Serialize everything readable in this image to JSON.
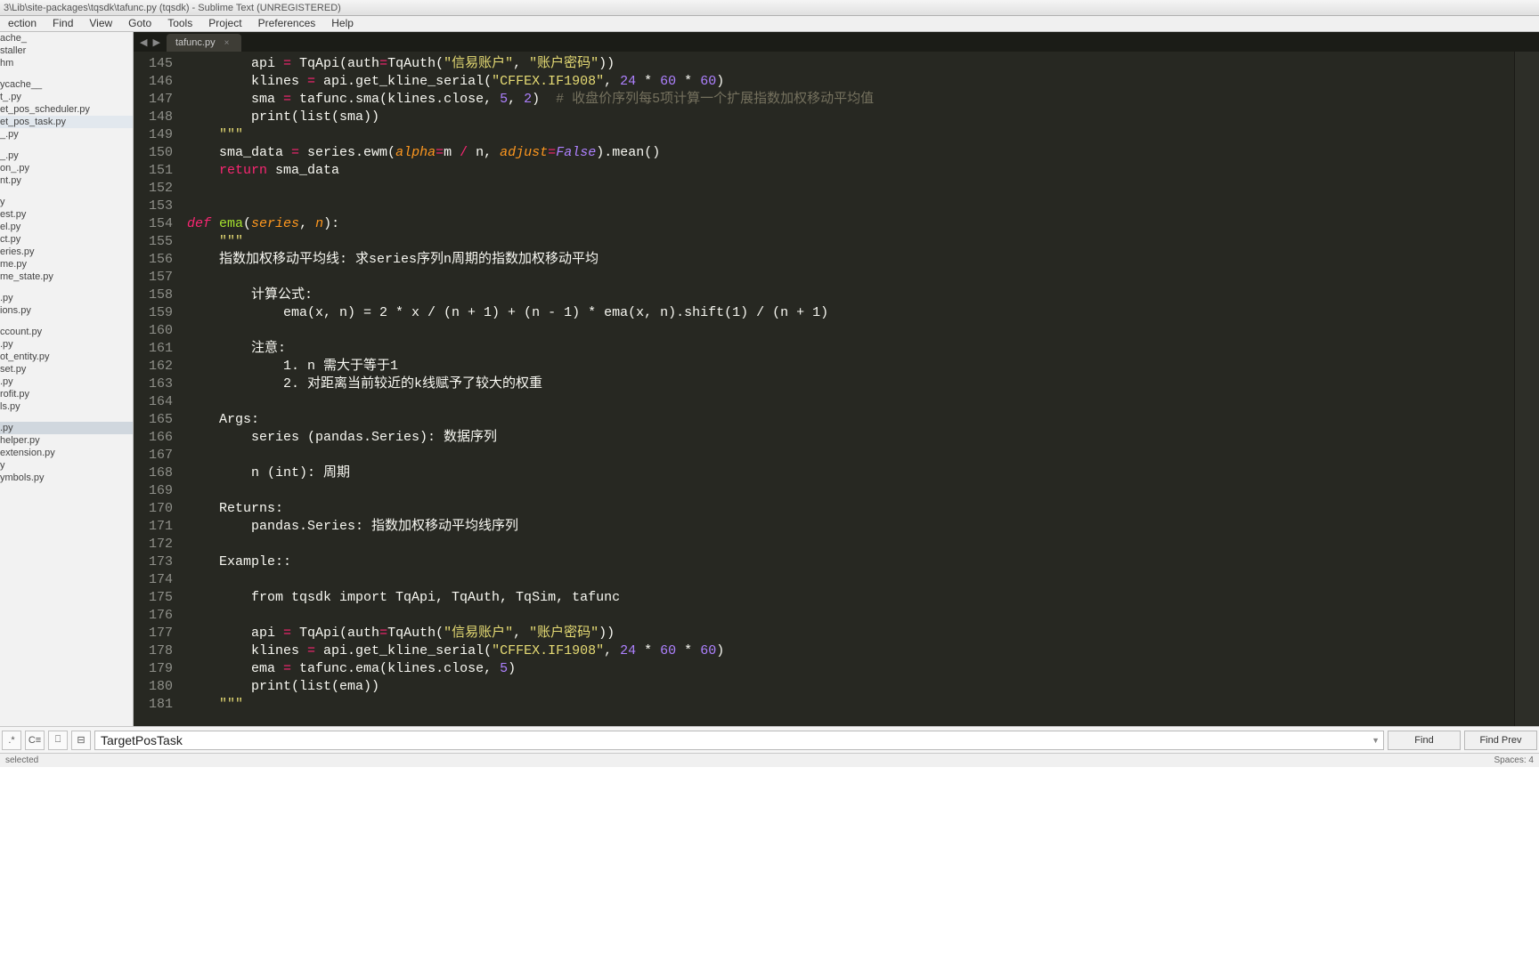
{
  "title": "3\\Lib\\site-packages\\tqsdk\\tafunc.py (tqsdk) - Sublime Text (UNREGISTERED)",
  "menu": [
    "ection",
    "Find",
    "View",
    "Goto",
    "Tools",
    "Project",
    "Preferences",
    "Help"
  ],
  "sidebar": {
    "groups": [
      [
        "ache_",
        "staller",
        "hm"
      ],
      [
        "ycache__",
        "t_.py",
        "et_pos_scheduler.py",
        "et_pos_task.py",
        "_.py"
      ],
      [
        "_.py",
        "on_.py",
        "nt.py"
      ],
      [
        "y",
        "est.py",
        "el.py",
        "ct.py",
        "eries.py",
        "me.py",
        "me_state.py"
      ],
      [
        ".py",
        "ions.py"
      ],
      [
        "ccount.py",
        ".py",
        "ot_entity.py",
        "set.py",
        ".py",
        "rofit.py",
        "ls.py"
      ],
      [
        ".py",
        "helper.py",
        "extension.py",
        "y",
        "ymbols.py"
      ]
    ],
    "selected": ".py",
    "highlighted": "et_pos_task.py"
  },
  "tab": {
    "label": "tafunc.py"
  },
  "lines_start": 145,
  "lines_end": 181,
  "code": [
    {
      "n": 145,
      "seg": [
        [
          "        api ",
          ""
        ],
        [
          "= ",
          "kw2"
        ],
        [
          "TqApi(auth",
          ""
        ],
        [
          "=",
          "kw2"
        ],
        [
          "TqAuth(",
          ""
        ],
        [
          "\"信易账户\"",
          "str"
        ],
        [
          ", ",
          ""
        ],
        [
          "\"账户密码\"",
          "str"
        ],
        [
          "))",
          ""
        ]
      ]
    },
    {
      "n": 146,
      "seg": [
        [
          "        klines ",
          ""
        ],
        [
          "= ",
          "kw2"
        ],
        [
          "api.get_kline_serial(",
          ""
        ],
        [
          "\"CFFEX.IF1908\"",
          "str"
        ],
        [
          ", ",
          ""
        ],
        [
          "24",
          "num"
        ],
        [
          " * ",
          ""
        ],
        [
          "60",
          "num"
        ],
        [
          " * ",
          ""
        ],
        [
          "60",
          "num"
        ],
        [
          ")",
          ""
        ]
      ]
    },
    {
      "n": 147,
      "seg": [
        [
          "        sma ",
          ""
        ],
        [
          "= ",
          "kw2"
        ],
        [
          "tafunc.sma(klines.close, ",
          ""
        ],
        [
          "5",
          "num"
        ],
        [
          ", ",
          ""
        ],
        [
          "2",
          "num"
        ],
        [
          ")  ",
          ""
        ],
        [
          "# 收盘价序列每5项计算一个扩展指数加权移动平均值",
          "cmt"
        ]
      ]
    },
    {
      "n": 148,
      "seg": [
        [
          "        print(list(sma))",
          ""
        ]
      ]
    },
    {
      "n": 149,
      "seg": [
        [
          "    ",
          ""
        ],
        [
          "\"\"\"",
          "str"
        ]
      ]
    },
    {
      "n": 150,
      "seg": [
        [
          "    sma_data ",
          ""
        ],
        [
          "= ",
          "kw2"
        ],
        [
          "series.ewm(",
          ""
        ],
        [
          "alpha",
          "param"
        ],
        [
          "=",
          "kw2"
        ],
        [
          "m ",
          ""
        ],
        [
          "/ ",
          "kw2"
        ],
        [
          "n, ",
          ""
        ],
        [
          "adjust",
          "param"
        ],
        [
          "=",
          "kw2"
        ],
        [
          "False",
          "const"
        ],
        [
          ").mean()",
          ""
        ]
      ]
    },
    {
      "n": 151,
      "seg": [
        [
          "    ",
          ""
        ],
        [
          "return",
          "kw2"
        ],
        [
          " sma_data",
          ""
        ]
      ]
    },
    {
      "n": 152,
      "seg": [
        [
          "",
          ""
        ]
      ]
    },
    {
      "n": 153,
      "seg": [
        [
          "",
          ""
        ]
      ]
    },
    {
      "n": 154,
      "seg": [
        [
          "def ",
          "kw"
        ],
        [
          "ema",
          "fn"
        ],
        [
          "(",
          ""
        ],
        [
          "series",
          "param"
        ],
        [
          ", ",
          ""
        ],
        [
          "n",
          "param"
        ],
        [
          "):",
          ""
        ]
      ]
    },
    {
      "n": 155,
      "seg": [
        [
          "    ",
          ""
        ],
        [
          "\"\"\"",
          "str"
        ]
      ]
    },
    {
      "n": 156,
      "seg": [
        [
          "    指数加权移动平均线: 求series序列n周期的指数加权移动平均",
          ""
        ]
      ]
    },
    {
      "n": 157,
      "seg": [
        [
          "",
          ""
        ]
      ]
    },
    {
      "n": 158,
      "seg": [
        [
          "        计算公式:",
          ""
        ]
      ]
    },
    {
      "n": 159,
      "seg": [
        [
          "            ema(x, n) = 2 * x / (n + 1) + (n - 1) * ema(x, n).shift(1) / (n + 1)",
          ""
        ]
      ]
    },
    {
      "n": 160,
      "seg": [
        [
          "",
          ""
        ]
      ]
    },
    {
      "n": 161,
      "seg": [
        [
          "        注意:",
          ""
        ]
      ]
    },
    {
      "n": 162,
      "seg": [
        [
          "            1. n 需大于等于1",
          ""
        ]
      ]
    },
    {
      "n": 163,
      "seg": [
        [
          "            2. 对距离当前较近的k线赋予了较大的权重",
          ""
        ]
      ]
    },
    {
      "n": 164,
      "seg": [
        [
          "",
          ""
        ]
      ]
    },
    {
      "n": 165,
      "seg": [
        [
          "    Args:",
          ""
        ]
      ]
    },
    {
      "n": 166,
      "seg": [
        [
          "        series (pandas.Series): 数据序列",
          ""
        ]
      ]
    },
    {
      "n": 167,
      "seg": [
        [
          "",
          ""
        ]
      ]
    },
    {
      "n": 168,
      "seg": [
        [
          "        n (int): 周期",
          ""
        ]
      ]
    },
    {
      "n": 169,
      "seg": [
        [
          "",
          ""
        ]
      ]
    },
    {
      "n": 170,
      "seg": [
        [
          "    Returns:",
          ""
        ]
      ]
    },
    {
      "n": 171,
      "seg": [
        [
          "        pandas.Series: 指数加权移动平均线序列",
          ""
        ]
      ]
    },
    {
      "n": 172,
      "seg": [
        [
          "",
          ""
        ]
      ]
    },
    {
      "n": 173,
      "seg": [
        [
          "    Example::",
          ""
        ]
      ]
    },
    {
      "n": 174,
      "seg": [
        [
          "",
          ""
        ]
      ]
    },
    {
      "n": 175,
      "seg": [
        [
          "        from tqsdk import TqApi, TqAuth, TqSim, tafunc",
          ""
        ]
      ]
    },
    {
      "n": 176,
      "seg": [
        [
          "",
          ""
        ]
      ]
    },
    {
      "n": 177,
      "seg": [
        [
          "        api ",
          ""
        ],
        [
          "= ",
          "kw2"
        ],
        [
          "TqApi(auth",
          ""
        ],
        [
          "=",
          "kw2"
        ],
        [
          "TqAuth(",
          ""
        ],
        [
          "\"信易账户\"",
          "str"
        ],
        [
          ", ",
          ""
        ],
        [
          "\"账户密码\"",
          "str"
        ],
        [
          "))",
          ""
        ]
      ]
    },
    {
      "n": 178,
      "seg": [
        [
          "        klines ",
          ""
        ],
        [
          "= ",
          "kw2"
        ],
        [
          "api.get_kline_serial(",
          ""
        ],
        [
          "\"CFFEX.IF1908\"",
          "str"
        ],
        [
          ", ",
          ""
        ],
        [
          "24",
          "num"
        ],
        [
          " * ",
          ""
        ],
        [
          "60",
          "num"
        ],
        [
          " * ",
          ""
        ],
        [
          "60",
          "num"
        ],
        [
          ")",
          ""
        ]
      ]
    },
    {
      "n": 179,
      "seg": [
        [
          "        ema ",
          ""
        ],
        [
          "= ",
          "kw2"
        ],
        [
          "tafunc.ema(klines.close, ",
          ""
        ],
        [
          "5",
          "num"
        ],
        [
          ")",
          ""
        ]
      ]
    },
    {
      "n": 180,
      "seg": [
        [
          "        print(list(ema))",
          ""
        ]
      ]
    },
    {
      "n": 181,
      "seg": [
        [
          "    ",
          ""
        ],
        [
          "\"\"\"",
          "str"
        ]
      ]
    }
  ],
  "find": {
    "icons": [
      ".*",
      "C≡",
      "⎕",
      "⊟"
    ],
    "value": "TargetPosTask",
    "buttons": [
      "Find",
      "Find Prev"
    ]
  },
  "status": {
    "left": "selected",
    "right": [
      "Spaces: 4"
    ]
  }
}
